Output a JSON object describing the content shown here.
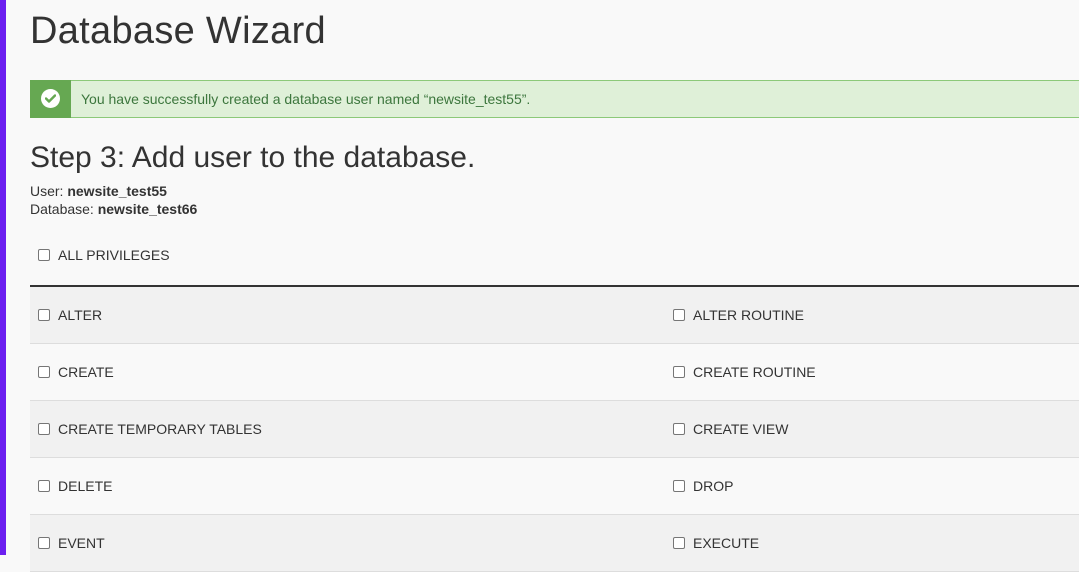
{
  "page_title": "Database Wizard",
  "alert": {
    "message": "You have successfully created a database user named “newsite_test55”.",
    "icon": "check-circle-icon"
  },
  "step_title": "Step 3: Add user to the database.",
  "user": {
    "label": "User:",
    "value": "newsite_test55"
  },
  "database": {
    "label": "Database:",
    "value": "newsite_test66"
  },
  "all_privileges": {
    "label": "ALL PRIVILEGES",
    "checked": false
  },
  "privileges": [
    {
      "left": "ALTER",
      "right": "ALTER ROUTINE"
    },
    {
      "left": "CREATE",
      "right": "CREATE ROUTINE"
    },
    {
      "left": "CREATE TEMPORARY TABLES",
      "right": "CREATE VIEW"
    },
    {
      "left": "DELETE",
      "right": "DROP"
    },
    {
      "left": "EVENT",
      "right": "EXECUTE"
    }
  ],
  "colors": {
    "accent": "#6c1ff0",
    "success_bg": "#dff0d8",
    "success_icon_bg": "#66a852",
    "success_text": "#3c763d"
  }
}
